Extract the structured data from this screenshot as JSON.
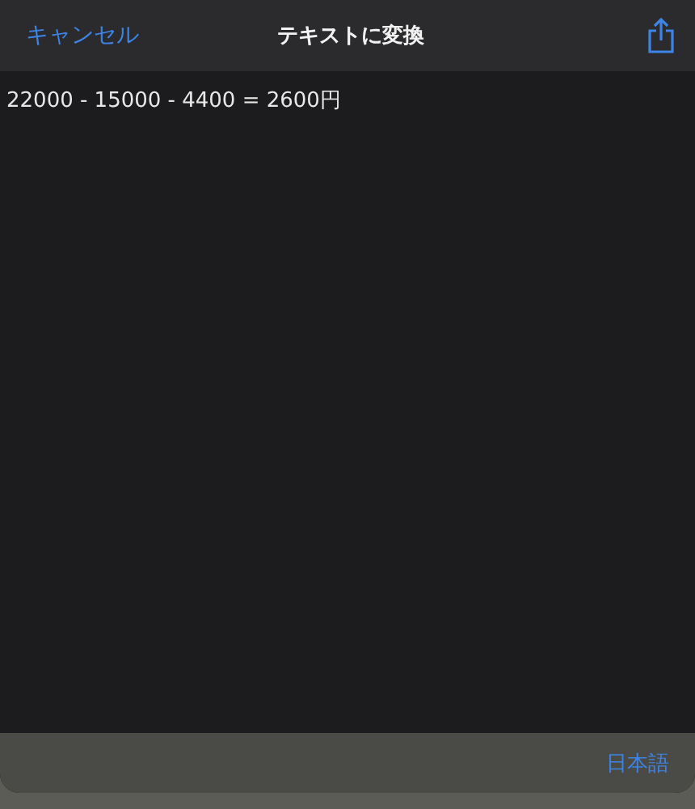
{
  "navigation_bar": {
    "cancel": "キャンセル",
    "title": "テキストに変換"
  },
  "text_content": "22000 - 15000 - 4400 = 2600円",
  "bottom_bar": {
    "language": "日本語"
  }
}
